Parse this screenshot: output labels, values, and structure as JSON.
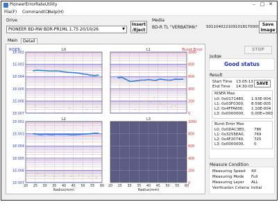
{
  "window": {
    "title": "PioneerErrorRateUtility"
  },
  "menu": {
    "file": "File(F)",
    "command": "Command(C)",
    "help": "Help(H)"
  },
  "drive": {
    "label": "Drive",
    "selected": "PIONEER BD-RW BDR-PR1ML 1.75 20/10/26"
  },
  "buttons": {
    "insert_eject": "Insert\n/Eject",
    "save_image": "Save\nImage",
    "stop": "STOP",
    "save": "SAVE"
  },
  "media": {
    "label": "Media",
    "name": "BD-R TL \"VERBATIMk\"",
    "id": "S01104022109101817000000"
  },
  "tabs": {
    "main": "Main",
    "detail": "Detail"
  },
  "chart_labels": {
    "left_axis": "RISER",
    "right_axis": "Burst Error",
    "xlabel": "Radius(mm)",
    "layers": [
      "L0",
      "L1",
      "L2",
      "L3"
    ]
  },
  "chart_data": {
    "type": "scatter",
    "xlabel": "Radius(mm)",
    "ylabel": "RISER",
    "y2label": "Burst Error",
    "xlim": [
      20,
      60
    ],
    "ylim": [
      1e-07,
      0.01
    ],
    "y_scale": "log",
    "y2lim": [
      0,
      1000
    ],
    "x_ticks": [
      20,
      25,
      30,
      35,
      40,
      45,
      50,
      55,
      60
    ],
    "y_ticks": [
      "1E-002",
      "1E-003",
      "1E-004",
      "1E-005",
      "1E-006",
      "1E-007"
    ],
    "y2_ticks": [
      1000,
      800,
      600,
      400,
      200,
      0
    ],
    "panels": [
      {
        "layer": "L0",
        "series": [
          {
            "name": "RISER",
            "x": [
              24,
              26,
              28,
              30,
              32,
              34,
              36,
              38,
              40,
              42,
              44,
              46,
              48,
              50,
              52,
              54,
              56,
              58
            ],
            "y": [
              0.0003,
              0.00032,
              0.00031,
              0.0003,
              0.00029,
              0.00028,
              0.00029,
              0.00027,
              0.00024,
              0.00022,
              0.00021,
              0.0002,
              0.00019,
              0.00016,
              0.00015,
              0.00013,
              0.00012,
              0.00013
            ]
          },
          {
            "name": "Burst Error",
            "x": [
              25,
              31,
              38,
              43,
              52,
              57
            ],
            "y": [
              120,
              90,
              60,
              80,
              60,
              100
            ]
          }
        ]
      },
      {
        "layer": "L1",
        "series": [
          {
            "name": "RISER",
            "x": [
              24,
              26,
              28,
              30,
              32,
              34,
              36,
              38,
              40,
              42,
              44,
              46,
              48,
              50,
              52,
              54,
              56,
              58
            ],
            "y": [
              8e-05,
              8.5e-05,
              6e-05,
              4e-05,
              4e-05,
              4.5e-05,
              5e-05,
              5e-05,
              5.5e-05,
              5e-05,
              4.8e-05,
              6e-05,
              5.5e-05,
              5e-05,
              5e-05,
              6e-05,
              5.8e-05,
              6e-05
            ]
          },
          {
            "name": "Burst Error",
            "x": [
              33,
              38,
              41,
              43,
              46,
              48,
              50,
              52,
              54
            ],
            "y": [
              60,
              200,
              180,
              250,
              150,
              120,
              200,
              100,
              120
            ]
          }
        ]
      },
      {
        "layer": "L2",
        "series": [
          {
            "name": "RISER",
            "x": [
              24,
              26,
              28,
              30,
              32,
              34,
              36,
              38,
              40,
              42,
              44,
              46,
              48,
              50,
              52,
              54,
              56,
              58
            ],
            "y": [
              0.001,
              0.0009,
              0.0008,
              0.0009,
              0.00085,
              0.0008,
              0.0009,
              0.00085,
              0.00088,
              0.00085,
              0.0008,
              0.00082,
              0.00085,
              0.0009,
              0.00095,
              0.001,
              0.0011,
              0.0011
            ]
          },
          {
            "name": "Burst Error",
            "x": [
              26,
              30,
              35,
              40,
              44,
              48,
              53,
              57
            ],
            "y": [
              150,
              120,
              100,
              110,
              100,
              120,
              90,
              80
            ]
          }
        ]
      },
      {
        "layer": "L3",
        "series": []
      }
    ]
  },
  "judge": {
    "label": "Judge",
    "status": "Good status"
  },
  "result": {
    "label": "Result",
    "start_time_label": "Start Time",
    "start_time": "13:05:13",
    "end_time_label": "End Time",
    "end_time": "14:30:03",
    "riser_max_label": "RISER Max",
    "riser_max": [
      {
        "layer": "L0: 0x0171480,",
        "value": "1.93E-004"
      },
      {
        "layer": "L1: 0x03F0300,",
        "value": "8.59E-005"
      },
      {
        "layer": "L2: 0x4FFA600,",
        "value": "1.10E-004"
      },
      {
        "layer": "L3: 0x0000000,",
        "value": "0.00E+000"
      }
    ],
    "burst_max_label": "Burst Error Max",
    "burst_max": [
      {
        "layer": "L0: 0x0DAC3E0,",
        "value": "786"
      },
      {
        "layer": "L1: 0x3255EA0,",
        "value": "769"
      },
      {
        "layer": "L2: 0x4F20740,",
        "value": "725"
      },
      {
        "layer": "L3: 0x0000000,",
        "value": "0"
      }
    ]
  },
  "measure": {
    "label": "Measure Condition",
    "rows": [
      {
        "k": "Measuring Speed",
        "v": "4X"
      },
      {
        "k": "Measuring Mode",
        "v": "Full"
      },
      {
        "k": "Measuring Layer",
        "v": "ALL"
      },
      {
        "k": "Verification Criteria",
        "v": "Initial"
      }
    ]
  },
  "colors": {
    "riser": "#2f7fdb",
    "burst": "#f0a020",
    "grid_blue": "#5a6cf0",
    "grid_red": "#e85a5a",
    "l3_fill": "#5c5c82"
  }
}
